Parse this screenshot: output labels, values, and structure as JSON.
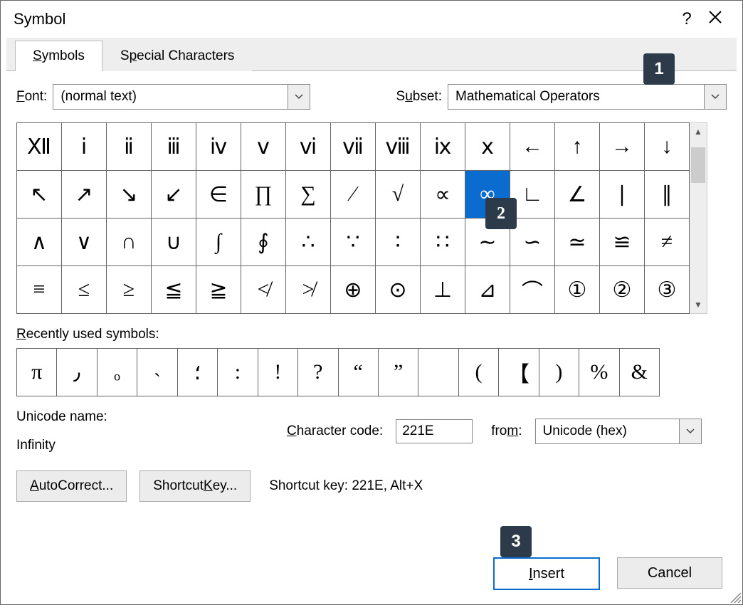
{
  "window": {
    "title": "Symbol"
  },
  "tabs": {
    "symbols": "Symbols",
    "special": "Special Characters"
  },
  "font": {
    "label": "Font:",
    "value": "(normal text)"
  },
  "subset": {
    "label": "Subset:",
    "value": "Mathematical Operators"
  },
  "grid": [
    [
      "Ⅻ",
      "ⅰ",
      "ⅱ",
      "ⅲ",
      "ⅳ",
      "ⅴ",
      "ⅵ",
      "ⅶ",
      "ⅷ",
      "ⅸ",
      "ⅹ",
      "←",
      "↑",
      "→",
      "↓"
    ],
    [
      "↖",
      "↗",
      "↘",
      "↙",
      "∈",
      "∏",
      "∑",
      "∕",
      "√",
      "∝",
      "∞",
      "∟",
      "∠",
      "∣",
      "∥"
    ],
    [
      "∧",
      "∨",
      "∩",
      "∪",
      "∫",
      "∮",
      "∴",
      "∵",
      "∶",
      "∷",
      "∼",
      "∽",
      "≃",
      "≌",
      "≠"
    ],
    [
      "≡",
      "≤",
      "≥",
      "≦",
      "≧",
      "≮",
      "≯",
      "⊕",
      "⊙",
      "⊥",
      "⊿",
      "⌒",
      "①",
      "②",
      "③"
    ]
  ],
  "grid_selected": {
    "row": 1,
    "col": 10
  },
  "recent_label": "Recently used symbols:",
  "recent": [
    "π",
    "٫",
    "ₒ",
    "˴",
    "؛",
    ":",
    "!",
    "?",
    "“",
    "”",
    "",
    "(",
    "【",
    ")",
    "%",
    "&"
  ],
  "unicode": {
    "name_label": "Unicode name:",
    "name": "Infinity"
  },
  "charcode": {
    "label": "Character code:",
    "value": "221E"
  },
  "from": {
    "label": "from:",
    "value": "Unicode (hex)"
  },
  "buttons": {
    "autocorrect": "AutoCorrect...",
    "shortcutkey": "Shortcut Key..."
  },
  "shortcut": {
    "label": "Shortcut key:",
    "value": "221E, Alt+X"
  },
  "footer": {
    "insert": "Insert",
    "cancel": "Cancel"
  },
  "badges": {
    "b1": "1",
    "b2": "2",
    "b3": "3"
  }
}
